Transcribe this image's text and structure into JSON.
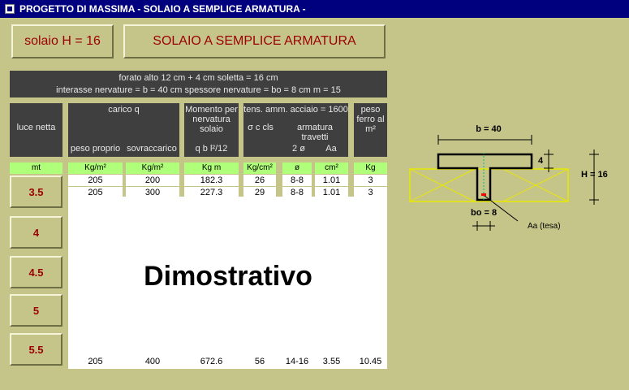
{
  "window": {
    "title": "PROGETTO DI MASSIMA - SOLAIO A SEMPLICE ARMATURA -"
  },
  "buttons": {
    "solaio_h": "solaio H = 16",
    "title": "SOLAIO A SEMPLICE ARMATURA"
  },
  "header": {
    "line1": "forato alto 12 cm + 4 cm soletta = 16 cm",
    "line2": "interasse nervature = b = 40 cm      spessore nervature = bo = 8 cm      m = 15"
  },
  "columns": {
    "luce": "luce netta",
    "carico": "carico q",
    "peso_proprio": "peso proprio",
    "sovraccarico": "sovraccarico",
    "momento": "Momento per nervatura solaio",
    "momento_formula": "q b l²/12",
    "tens": "tens. amm. acciaio = 1600",
    "sigma": "σ c cls",
    "armatura": "armatura travetti",
    "two_phi": "2 ø",
    "aa": "Aa",
    "peso_ferro": "peso ferro al m²"
  },
  "units": [
    "mt",
    "Kg/m²",
    "Kg/m²",
    "Kg m",
    "Kg/cm²",
    "ø",
    "cm²",
    "Kg"
  ],
  "rows": [
    [
      "205",
      "200",
      "182.3",
      "26",
      "8-8",
      "1.01",
      "3"
    ],
    [
      "205",
      "300",
      "227.3",
      "29",
      "8-8",
      "1.01",
      "3"
    ],
    [
      "205",
      "400",
      "672.6",
      "56",
      "14-16",
      "3.55",
      "10.45"
    ]
  ],
  "luce_buttons": [
    "3.5",
    "4",
    "4.5",
    "5",
    "5.5"
  ],
  "overlay_text": "Dimostrativo",
  "diagram": {
    "b": "b = 40",
    "four": "4",
    "h": "H = 16",
    "bo": "bo = 8",
    "aa": "Aa (tesa)"
  }
}
